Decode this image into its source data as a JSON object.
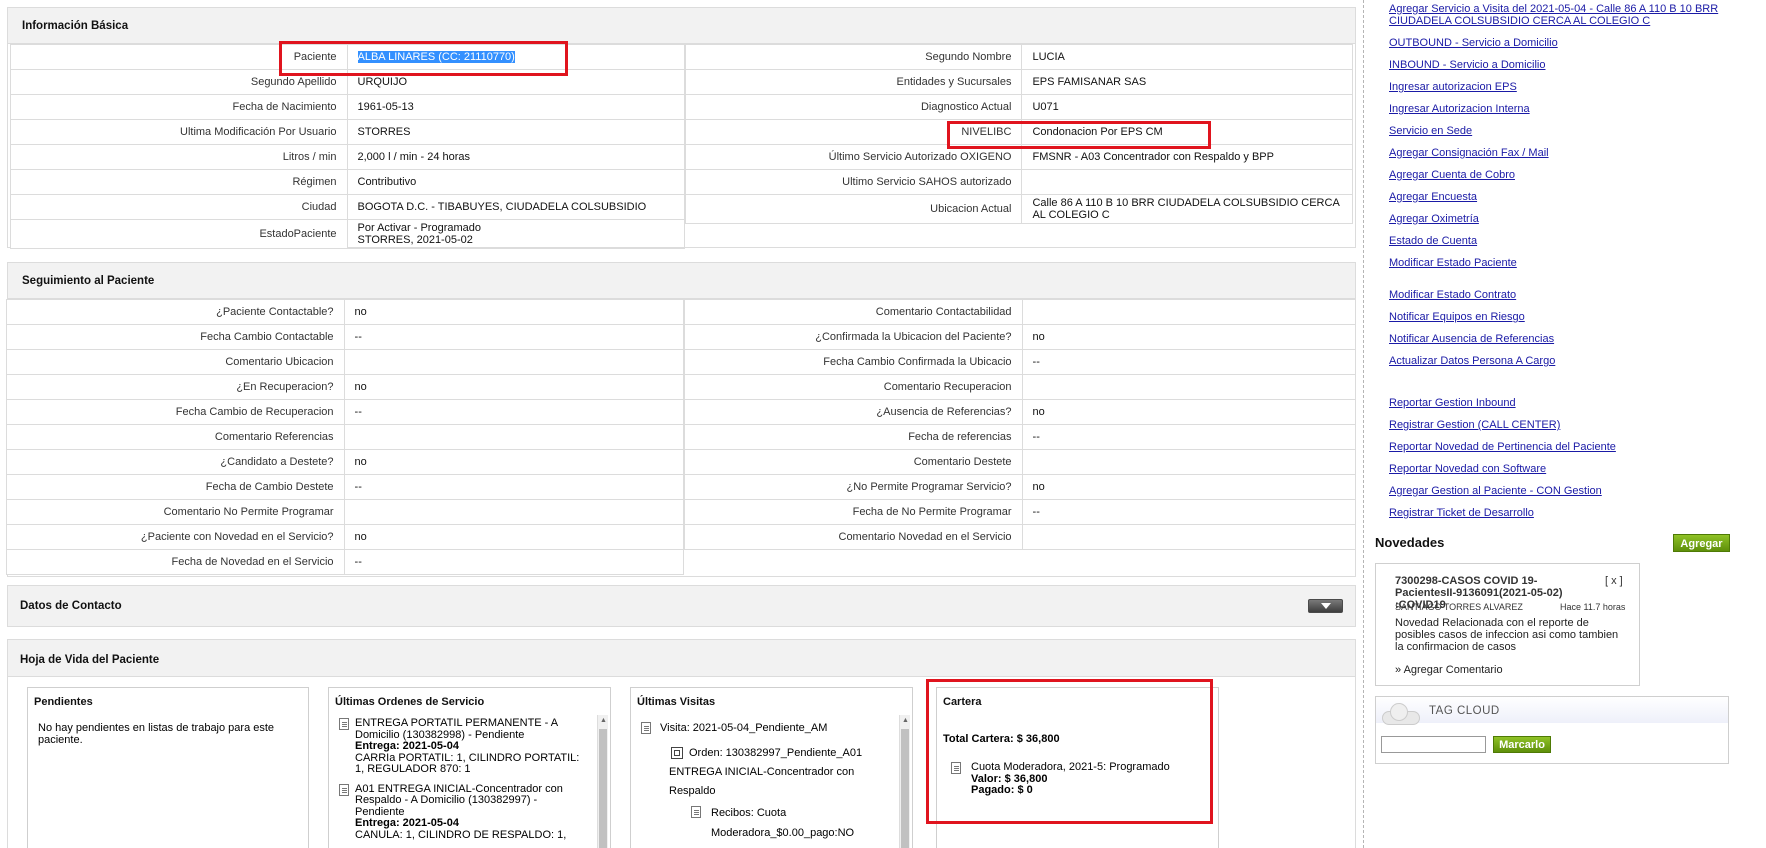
{
  "info": {
    "title": "Información Básica",
    "left": [
      {
        "label": "Paciente",
        "value": "ALBA LINARES (CC: 21110770)"
      },
      {
        "label": "Segundo Apellido",
        "value": "URQUIJO"
      },
      {
        "label": "Fecha de Nacimiento",
        "value": "1961-05-13"
      },
      {
        "label": "Ultima Modificación Por Usuario",
        "value": "STORRES"
      },
      {
        "label": "Litros / min",
        "value": "2,000 l / min - 24 horas"
      },
      {
        "label": "Régimen",
        "value": "Contributivo"
      },
      {
        "label": "Ciudad",
        "value": "BOGOTA D.C. - TIBABUYES, CIUDADELA COLSUBSIDIO"
      },
      {
        "label": "EstadoPaciente",
        "value": "Por Activar - Programado",
        "value2": "STORRES, 2021-05-02"
      }
    ],
    "right": [
      {
        "label": "Segundo Nombre",
        "value": "LUCIA"
      },
      {
        "label": "Entidades y Sucursales",
        "value": "EPS FAMISANAR SAS"
      },
      {
        "label": "Diagnostico Actual",
        "value": "U071"
      },
      {
        "label": "NIVELIBC",
        "value": "Condonacion Por EPS CM"
      },
      {
        "label": "Último Servicio Autorizado OXIGENO",
        "value": "FMSNR - A03 Concentrador con Respaldo y BPP"
      },
      {
        "label": "Ultimo Servicio SAHOS autorizado",
        "value": ""
      },
      {
        "label": "Ubicacion Actual",
        "value": "Calle 86 A 110 B 10 BRR CIUDADELA COLSUBSIDIO CERCA AL COLEGIO C"
      }
    ]
  },
  "seguimiento": {
    "title": "Seguimiento al Paciente",
    "left": [
      {
        "label": "¿Paciente Contactable?",
        "value": "no"
      },
      {
        "label": "Fecha Cambio Contactable",
        "value": "--"
      },
      {
        "label": "Comentario Ubicacion",
        "value": ""
      },
      {
        "label": "¿En Recuperacion?",
        "value": "no"
      },
      {
        "label": "Fecha Cambio de Recuperacion",
        "value": "--"
      },
      {
        "label": "Comentario Referencias",
        "value": ""
      },
      {
        "label": "¿Candidato a Destete?",
        "value": "no"
      },
      {
        "label": "Fecha de Cambio Destete",
        "value": "--"
      },
      {
        "label": "Comentario No Permite Programar",
        "value": ""
      },
      {
        "label": "¿Paciente con Novedad en el Servicio?",
        "value": "no"
      },
      {
        "label": "Fecha de Novedad en el Servicio",
        "value": "--"
      }
    ],
    "right": [
      {
        "label": "Comentario Contactabilidad",
        "value": ""
      },
      {
        "label": "¿Confirmada la Ubicacion del Paciente?",
        "value": "no"
      },
      {
        "label": "Fecha Cambio Confirmada la Ubicacio",
        "value": "--"
      },
      {
        "label": "Comentario Recuperacion",
        "value": ""
      },
      {
        "label": "¿Ausencia de Referencias?",
        "value": "no"
      },
      {
        "label": "Fecha de referencias",
        "value": "--"
      },
      {
        "label": "Comentario Destete",
        "value": ""
      },
      {
        "label": "¿No Permite Programar Servicio?",
        "value": "no"
      },
      {
        "label": "Fecha de No Permite Programar",
        "value": "--"
      },
      {
        "label": "Comentario Novedad en el Servicio",
        "value": ""
      }
    ]
  },
  "contacto": {
    "title": "Datos de Contacto"
  },
  "hoja": {
    "title": "Hoja de Vida del Paciente",
    "pendientes": {
      "title": "Pendientes",
      "text": "No hay pendientes en listas de trabajo para este paciente."
    },
    "ordenes": {
      "title": "Últimas Ordenes de Servicio",
      "items": [
        {
          "desc": "ENTREGA PORTATIL PERMANENTE - A Domicilio (130382998) - Pendiente",
          "entrega": "Entrega: 2021-05-04",
          "detail": "CARRIa PORTATIL: 1, CILINDRO PORTATIL: 1, REGULADOR 870: 1"
        },
        {
          "desc": "A01 ENTREGA INICIAL-Concentrador con Respaldo - A Domicilio (130382997) - Pendiente",
          "entrega": "Entrega: 2021-05-04",
          "detail": "CANULA: 1, CILINDRO DE RESPALDO: 1,"
        }
      ]
    },
    "visitas": {
      "title": "Últimas Visitas",
      "visita": "Visita: 2021-05-04_Pendiente_AM",
      "orden": "Orden: 130382997_Pendiente_A01 ENTREGA INICIAL-Concentrador con Respaldo",
      "recibos": "Recibos: Cuota Moderadora_$0.00_pago:NO"
    },
    "cartera": {
      "title": "Cartera",
      "total": "Total Cartera: $ 36,800",
      "cuota": "Cuota Moderadora, 2021-5: Programado",
      "valor": "Valor: $ 36,800",
      "pagado": "Pagado: $ 0"
    }
  },
  "links_top": [
    "Agregar Servicio a Visita del 2021-05-04 - Calle 86 A 110 B 10 BRR CIUDADELA COLSUBSIDIO CERCA AL COLEGIO C",
    "OUTBOUND - Servicio a Domicilio",
    "INBOUND - Servicio a Domicilio",
    "Ingresar autorizacion EPS",
    "Ingresar Autorizacion Interna",
    "Servicio en Sede",
    "Agregar Consignación Fax / Mail",
    "Agregar Cuenta de Cobro",
    "Agregar Encuesta",
    "Agregar Oximetría",
    "Estado de Cuenta",
    "Modificar Estado Paciente"
  ],
  "links_mid": [
    "Modificar Estado Contrato",
    "Notificar Equipos en Riesgo",
    "Notificar Ausencia de Referencias",
    "Actualizar Datos Persona A Cargo"
  ],
  "links_bottom": [
    "Reportar Gestion Inbound",
    "Registrar Gestion (CALL CENTER)",
    "Reportar Novedad de Pertinencia del Paciente",
    "Reportar Novedad con Software",
    "Agregar Gestion al Paciente - CON Gestion",
    "Registrar Ticket de Desarrollo"
  ],
  "novedades": {
    "title": "Novedades",
    "add_label": "Agregar",
    "item_title": "7300298-CASOS COVID 19-PacientesII-9136091(2021-05-02) :COVID19",
    "close": "[ x ]",
    "author": "SANTIAGO TORRES ALVAREZ",
    "time": "Hace 11.7 horas",
    "body": "Novedad Relacionada con el reporte de posibles casos de infeccion asi como tambien la confirmacion de casos",
    "comment": "» Agregar Comentario"
  },
  "tagcloud": {
    "title": "TAG CLOUD",
    "button": "Marcarlo",
    "input_value": ""
  }
}
